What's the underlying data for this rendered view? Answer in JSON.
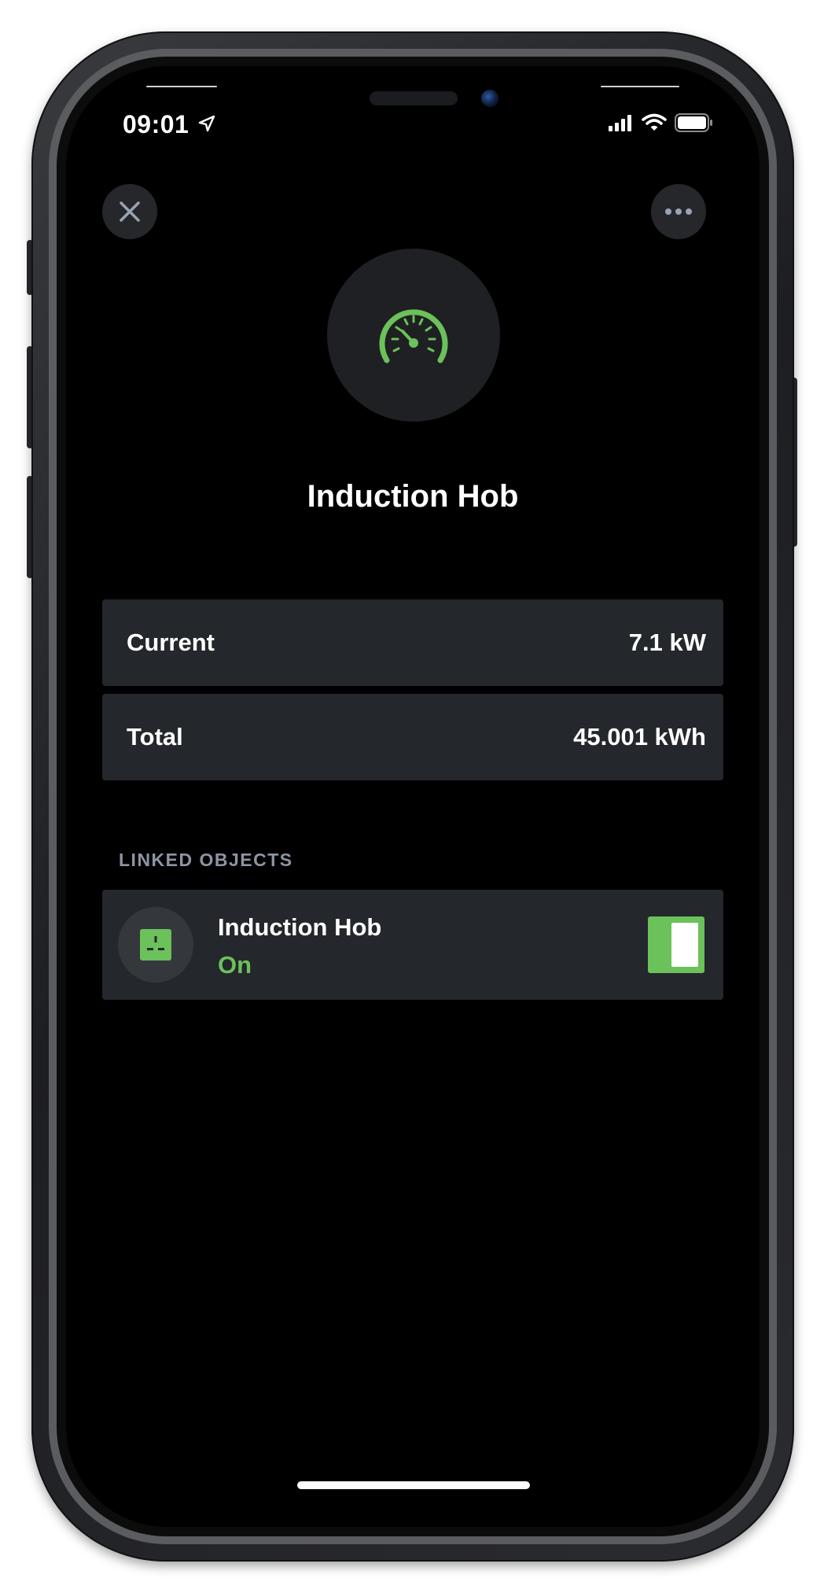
{
  "status_bar": {
    "time": "09:01"
  },
  "header": {
    "close_icon": "close-icon",
    "more_icon": "ellipsis-icon"
  },
  "device": {
    "icon": "gauge-icon",
    "name": "Induction Hob",
    "accent_color": "#6bc15a"
  },
  "metrics": [
    {
      "label": "Current",
      "value": "7.1 kW"
    },
    {
      "label": "Total",
      "value": "45.001 kWh"
    }
  ],
  "linked_objects": {
    "section_label": "LINKED OBJECTS",
    "items": [
      {
        "icon": "power-socket-icon",
        "name": "Induction Hob",
        "status": "On",
        "switch_on": true
      }
    ]
  }
}
